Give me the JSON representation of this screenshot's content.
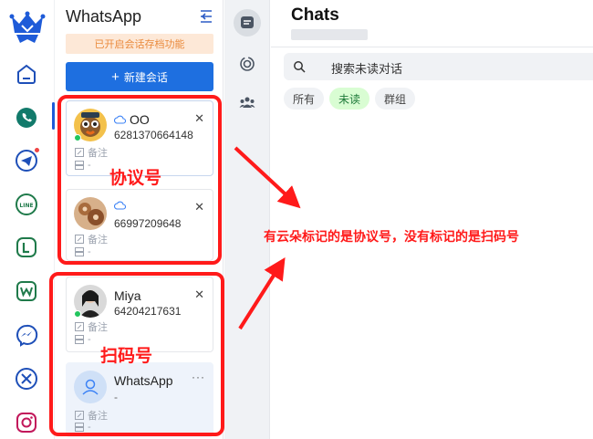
{
  "rail": {
    "logo": "crown-logo",
    "icons": [
      "home-icon",
      "whatsapp-icon",
      "telegram-icon",
      "line-icon",
      "line-business-icon",
      "wecom-icon",
      "messenger-icon",
      "x-icon",
      "instagram-icon"
    ],
    "telegram_badge": true
  },
  "accounts_panel": {
    "title": "WhatsApp",
    "archive_tip": "已开启会话存档功能",
    "new_chat_button": "新建会话",
    "note_label": "备注",
    "dash": "-",
    "accounts": [
      {
        "name": "OO",
        "phone": "6281370664148",
        "cloud": true,
        "online": true
      },
      {
        "name": "",
        "phone": "66997209648",
        "cloud": true,
        "online": false
      },
      {
        "name": "Miya",
        "phone": "64204217631",
        "cloud": false,
        "online": true
      },
      {
        "name": "WhatsApp",
        "phone": "-",
        "cloud": false,
        "online": false
      }
    ]
  },
  "mid_nav": {
    "items": [
      "chats-icon",
      "status-icon",
      "communities-icon"
    ]
  },
  "chats": {
    "title": "Chats",
    "search_placeholder": "搜索未读对话",
    "filters": [
      "所有",
      "未读",
      "群组"
    ],
    "active_filter": "未读"
  },
  "annotations": {
    "protocol_label": "协议号",
    "scan_label": "扫码号",
    "note": "有云朵标记的是协议号，没有标记的是扫码号",
    "color": "#ff1a1a"
  }
}
